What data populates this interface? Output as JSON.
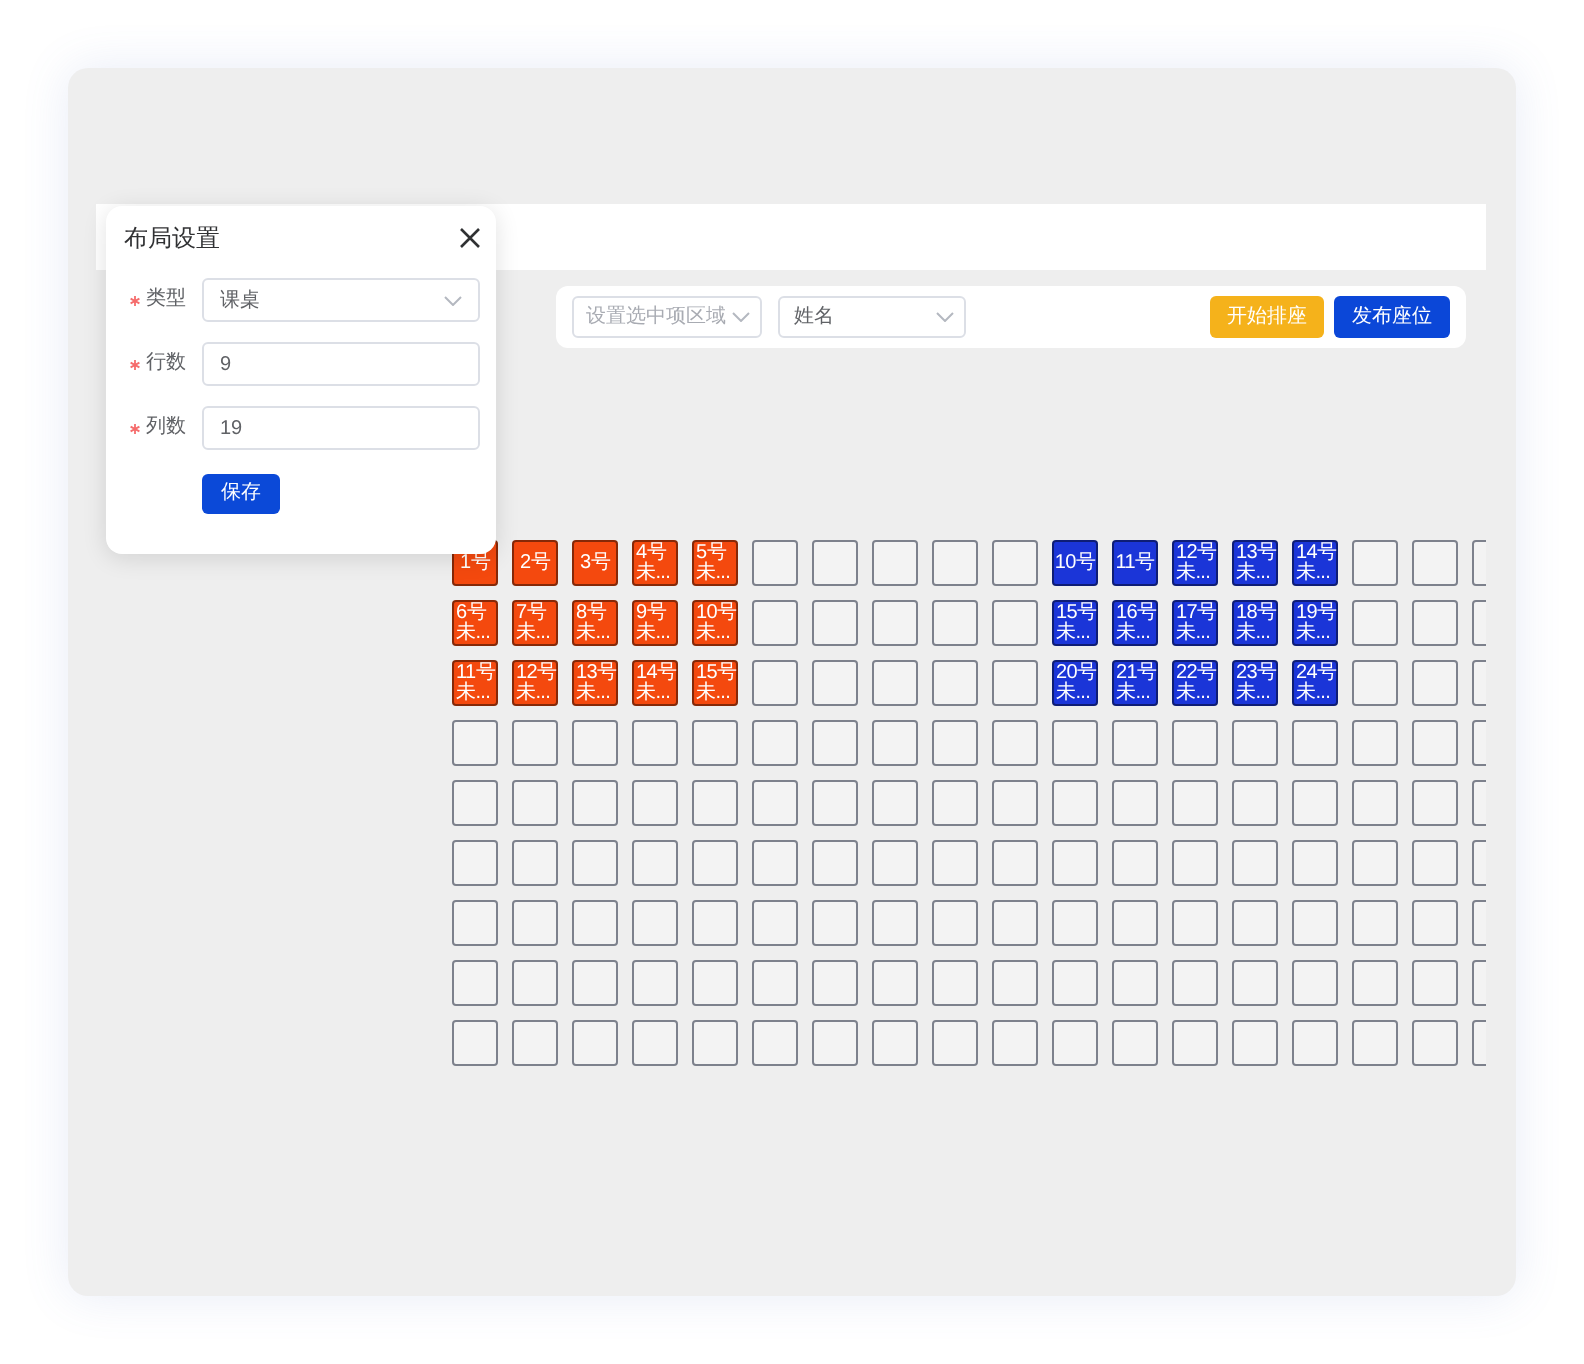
{
  "popover": {
    "title": "布局设置",
    "fields": [
      {
        "label": "类型",
        "required": true,
        "kind": "select",
        "value": "课桌"
      },
      {
        "label": "行数",
        "required": true,
        "kind": "input",
        "value": "9"
      },
      {
        "label": "列数",
        "required": true,
        "kind": "input",
        "value": "19"
      }
    ],
    "button": "保存"
  },
  "toolbar": {
    "selects": [
      {
        "placeholder": "设置选中项区域"
      },
      {
        "value": "姓名"
      }
    ],
    "buttons": [
      {
        "label": "开始排座",
        "kind": "warning"
      },
      {
        "label": "发布座位",
        "kind": "primary"
      }
    ]
  },
  "seat_grid": {
    "rows": [
      {
        "seats": [
          {
            "kind": "seat",
            "color": "#f4490e",
            "number": "1号"
          },
          {
            "kind": "seat",
            "color": "#f4490e",
            "number": "2号"
          },
          {
            "kind": "seat",
            "color": "#f4490e",
            "number": "3号"
          },
          {
            "kind": "seat",
            "color": "#f4490e",
            "number": "4号",
            "name": "未..."
          },
          {
            "kind": "seat",
            "color": "#f4490e",
            "number": "5号",
            "name": "未..."
          },
          {
            "kind": "empty"
          },
          {
            "kind": "empty"
          },
          {
            "kind": "empty"
          },
          {
            "kind": "empty"
          },
          {
            "kind": "empty"
          },
          {
            "kind": "seat",
            "color": "#1b35d8",
            "number": "10号"
          },
          {
            "kind": "seat",
            "color": "#1b35d8",
            "number": "11号"
          },
          {
            "kind": "seat",
            "color": "#1b35d8",
            "number": "12号",
            "name": "未..."
          },
          {
            "kind": "seat",
            "color": "#1b35d8",
            "number": "13号",
            "name": "未..."
          },
          {
            "kind": "seat",
            "color": "#1b35d8",
            "number": "14号",
            "name": "未..."
          },
          {
            "kind": "empty"
          },
          {
            "kind": "empty"
          },
          {
            "kind": "empty"
          }
        ]
      },
      {
        "seats": [
          {
            "kind": "seat",
            "color": "#f4490e",
            "number": "6号",
            "name": "未..."
          },
          {
            "kind": "seat",
            "color": "#f4490e",
            "number": "7号",
            "name": "未..."
          },
          {
            "kind": "seat",
            "color": "#f4490e",
            "number": "8号",
            "name": "未..."
          },
          {
            "kind": "seat",
            "color": "#f4490e",
            "number": "9号",
            "name": "未..."
          },
          {
            "kind": "seat",
            "color": "#f4490e",
            "number": "10号",
            "name": "未..."
          },
          {
            "kind": "empty"
          },
          {
            "kind": "empty"
          },
          {
            "kind": "empty"
          },
          {
            "kind": "empty"
          },
          {
            "kind": "empty"
          },
          {
            "kind": "seat",
            "color": "#1b35d8",
            "number": "15号",
            "name": "未..."
          },
          {
            "kind": "seat",
            "color": "#1b35d8",
            "number": "16号",
            "name": "未..."
          },
          {
            "kind": "seat",
            "color": "#1b35d8",
            "number": "17号",
            "name": "未..."
          },
          {
            "kind": "seat",
            "color": "#1b35d8",
            "number": "18号",
            "name": "未..."
          },
          {
            "kind": "seat",
            "color": "#1b35d8",
            "number": "19号",
            "name": "未..."
          },
          {
            "kind": "empty"
          },
          {
            "kind": "empty"
          },
          {
            "kind": "empty"
          }
        ]
      },
      {
        "seats": [
          {
            "kind": "seat",
            "color": "#f4490e",
            "number": "11号",
            "name": "未..."
          },
          {
            "kind": "seat",
            "color": "#f4490e",
            "number": "12号",
            "name": "未..."
          },
          {
            "kind": "seat",
            "color": "#f4490e",
            "number": "13号",
            "name": "未..."
          },
          {
            "kind": "seat",
            "color": "#f4490e",
            "number": "14号",
            "name": "未..."
          },
          {
            "kind": "seat",
            "color": "#f4490e",
            "number": "15号",
            "name": "未..."
          },
          {
            "kind": "empty"
          },
          {
            "kind": "empty"
          },
          {
            "kind": "empty"
          },
          {
            "kind": "empty"
          },
          {
            "kind": "empty"
          },
          {
            "kind": "seat",
            "color": "#1b35d8",
            "number": "20号",
            "name": "未..."
          },
          {
            "kind": "seat",
            "color": "#1b35d8",
            "number": "21号",
            "name": "未..."
          },
          {
            "kind": "seat",
            "color": "#1b35d8",
            "number": "22号",
            "name": "未..."
          },
          {
            "kind": "seat",
            "color": "#1b35d8",
            "number": "23号",
            "name": "未..."
          },
          {
            "kind": "seat",
            "color": "#1b35d8",
            "number": "24号",
            "name": "未..."
          },
          {
            "kind": "empty"
          },
          {
            "kind": "empty"
          },
          {
            "kind": "empty"
          }
        ]
      },
      {
        "seats": [
          {
            "kind": "empty"
          },
          {
            "kind": "empty"
          },
          {
            "kind": "empty"
          },
          {
            "kind": "empty"
          },
          {
            "kind": "empty"
          },
          {
            "kind": "empty"
          },
          {
            "kind": "empty"
          },
          {
            "kind": "empty"
          },
          {
            "kind": "empty"
          },
          {
            "kind": "empty"
          },
          {
            "kind": "empty"
          },
          {
            "kind": "empty"
          },
          {
            "kind": "empty"
          },
          {
            "kind": "empty"
          },
          {
            "kind": "empty"
          },
          {
            "kind": "empty"
          },
          {
            "kind": "empty"
          },
          {
            "kind": "empty"
          }
        ]
      },
      {
        "seats": [
          {
            "kind": "empty"
          },
          {
            "kind": "empty"
          },
          {
            "kind": "empty"
          },
          {
            "kind": "empty"
          },
          {
            "kind": "empty"
          },
          {
            "kind": "empty"
          },
          {
            "kind": "empty"
          },
          {
            "kind": "empty"
          },
          {
            "kind": "empty"
          },
          {
            "kind": "empty"
          },
          {
            "kind": "empty"
          },
          {
            "kind": "empty"
          },
          {
            "kind": "empty"
          },
          {
            "kind": "empty"
          },
          {
            "kind": "empty"
          },
          {
            "kind": "empty"
          },
          {
            "kind": "empty"
          },
          {
            "kind": "empty"
          }
        ]
      },
      {
        "seats": [
          {
            "kind": "empty"
          },
          {
            "kind": "empty"
          },
          {
            "kind": "empty"
          },
          {
            "kind": "empty"
          },
          {
            "kind": "empty"
          },
          {
            "kind": "empty"
          },
          {
            "kind": "empty"
          },
          {
            "kind": "empty"
          },
          {
            "kind": "empty"
          },
          {
            "kind": "empty"
          },
          {
            "kind": "empty"
          },
          {
            "kind": "empty"
          },
          {
            "kind": "empty"
          },
          {
            "kind": "empty"
          },
          {
            "kind": "empty"
          },
          {
            "kind": "empty"
          },
          {
            "kind": "empty"
          },
          {
            "kind": "empty"
          }
        ]
      },
      {
        "seats": [
          {
            "kind": "empty"
          },
          {
            "kind": "empty"
          },
          {
            "kind": "empty"
          },
          {
            "kind": "empty"
          },
          {
            "kind": "empty"
          },
          {
            "kind": "empty"
          },
          {
            "kind": "empty"
          },
          {
            "kind": "empty"
          },
          {
            "kind": "empty"
          },
          {
            "kind": "empty"
          },
          {
            "kind": "empty"
          },
          {
            "kind": "empty"
          },
          {
            "kind": "empty"
          },
          {
            "kind": "empty"
          },
          {
            "kind": "empty"
          },
          {
            "kind": "empty"
          },
          {
            "kind": "empty"
          },
          {
            "kind": "empty"
          }
        ]
      },
      {
        "seats": [
          {
            "kind": "empty"
          },
          {
            "kind": "empty"
          },
          {
            "kind": "empty"
          },
          {
            "kind": "empty"
          },
          {
            "kind": "empty"
          },
          {
            "kind": "empty"
          },
          {
            "kind": "empty"
          },
          {
            "kind": "empty"
          },
          {
            "kind": "empty"
          },
          {
            "kind": "empty"
          },
          {
            "kind": "empty"
          },
          {
            "kind": "empty"
          },
          {
            "kind": "empty"
          },
          {
            "kind": "empty"
          },
          {
            "kind": "empty"
          },
          {
            "kind": "empty"
          },
          {
            "kind": "empty"
          },
          {
            "kind": "empty"
          }
        ]
      },
      {
        "seats": [
          {
            "kind": "empty"
          },
          {
            "kind": "empty"
          },
          {
            "kind": "empty"
          },
          {
            "kind": "empty"
          },
          {
            "kind": "empty"
          },
          {
            "kind": "empty"
          },
          {
            "kind": "empty"
          },
          {
            "kind": "empty"
          },
          {
            "kind": "empty"
          },
          {
            "kind": "empty"
          },
          {
            "kind": "empty"
          },
          {
            "kind": "empty"
          },
          {
            "kind": "empty"
          },
          {
            "kind": "empty"
          },
          {
            "kind": "empty"
          },
          {
            "kind": "empty"
          },
          {
            "kind": "empty"
          },
          {
            "kind": "empty"
          }
        ]
      }
    ]
  }
}
